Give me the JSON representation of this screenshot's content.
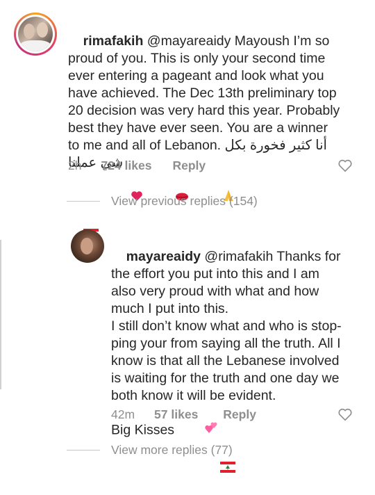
{
  "comment1": {
    "username": "rimafakih",
    "mention": "@mayareaidy",
    "text_lines": [
      " Mayoush I’m so",
      "proud of you. This is only your second time",
      "ever entering a pageant and look what you",
      "have achieved. The Dec 13th preliminary top",
      "20 decision was very hard this year. Probably",
      "best they have ever seen. You are a winner",
      "to me and all of Lebanon."
    ],
    "arabic_line1": "أنا كثير فخورة بكل",
    "arabic_line2": "شي عملنا",
    "emojis": [
      "flag-lebanon-icon",
      "heart-icon",
      "lips-icon",
      "praying-hands-icon"
    ],
    "time": "2h",
    "likes": "724 likes",
    "reply": "Reply",
    "avatar_icon": "profile-avatar-icon"
  },
  "view_previous": {
    "label": "View previous replies (154)"
  },
  "comment2": {
    "username": "mayareaidy",
    "mention": "@rimafakih",
    "text_lines": [
      " Thanks for",
      "the effort you put into this and I am",
      "also very proud with what and how",
      "much I put into this.",
      "I still don’t know what and who is stop-",
      "ping your from saying all the truth. All I",
      "know is that all the Lebanese involved",
      "is waiting for the truth and one day we",
      "both know it will be evident.",
      "Big Kisses"
    ],
    "emojis": [
      "two-hearts-icon",
      "flag-lebanon-icon"
    ],
    "time": "42m",
    "likes": "57 likes",
    "reply": "Reply",
    "avatar_icon": "profile-avatar-icon"
  },
  "view_more": {
    "label": "View more replies (77)"
  },
  "colors": {
    "text": "#262626",
    "meta": "#8e8e8e",
    "flag_red": "#e0202d",
    "flag_green": "#1e8a3a",
    "heart_red": "#e0245e"
  }
}
